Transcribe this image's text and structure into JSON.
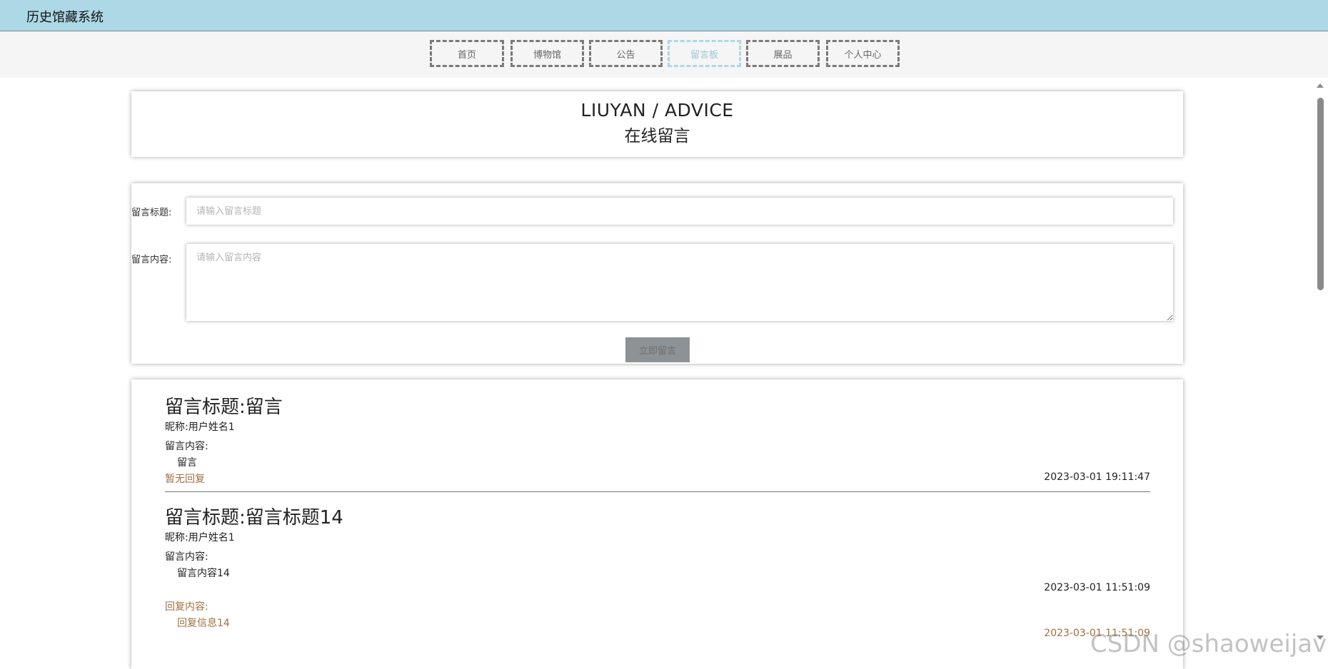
{
  "app": {
    "title": "历史馆藏系统"
  },
  "nav": {
    "items": [
      {
        "label": "首页"
      },
      {
        "label": "博物馆"
      },
      {
        "label": "公告"
      },
      {
        "label": "留言板"
      },
      {
        "label": "展品"
      },
      {
        "label": "个人中心"
      }
    ],
    "active_index": 3,
    "active_color": "#add8e6"
  },
  "header": {
    "title_en": "LIUYAN / ADVICE",
    "title_cn": "在线留言"
  },
  "form": {
    "title_label": "留言标题:",
    "title_placeholder": "请输入留言标题",
    "title_value": "",
    "content_label": "留言内容:",
    "content_placeholder": "请输入留言内容",
    "content_value": "",
    "submit_label": "立即留言"
  },
  "messages": [
    {
      "title": "留言标题:留言",
      "nickname": "昵称:用户姓名1",
      "content_label": "留言内容:",
      "content": "留言",
      "no_reply": "暂无回复",
      "time": "2023-03-01 19:11:47"
    },
    {
      "title": "留言标题:留言标题14",
      "nickname": "昵称:用户姓名1",
      "content_label": "留言内容:",
      "content": "留言内容14",
      "time": "2023-03-01 11:51:09",
      "reply_label": "回复内容:",
      "reply_content": "回复信息14",
      "reply_time": "2023-03-01 11:51:09"
    }
  ],
  "watermark": "CSDN @shaoweijava",
  "colors": {
    "topbar": "#add8e6",
    "reply": "#a0713f",
    "button": "#8c9296"
  }
}
